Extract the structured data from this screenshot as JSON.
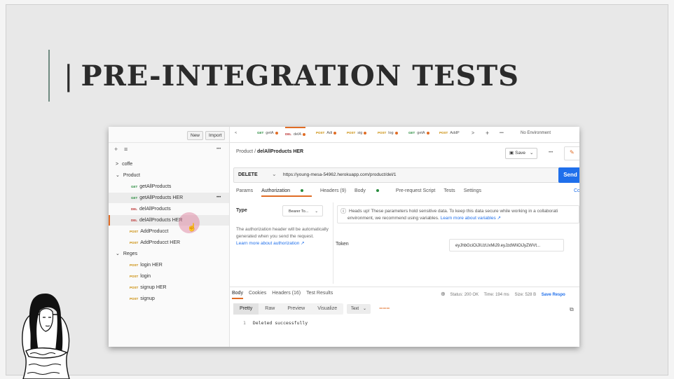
{
  "slide": {
    "title_bar": "|",
    "title": "PRE-INTEGRATION TESTS"
  },
  "sidebar": {
    "new_btn": "New",
    "import_btn": "Import",
    "tools": {
      "plus": "+",
      "filter": "≡",
      "more": "•••"
    },
    "tree": [
      {
        "type": "folder",
        "label": "coffe",
        "icon": "chevron-right-icon"
      },
      {
        "type": "folder",
        "label": "Product",
        "icon": "chevron-down-icon"
      },
      {
        "type": "req",
        "method": "GET",
        "label": "getAllProducts"
      },
      {
        "type": "req",
        "method": "GET",
        "label": "getAllProducts HER",
        "more": "•••"
      },
      {
        "type": "req",
        "method": "DEL",
        "label": "delAllProducts"
      },
      {
        "type": "req",
        "method": "DEL",
        "label": "delAllProducts HER"
      },
      {
        "type": "req",
        "method": "POST",
        "label": "AddProducct"
      },
      {
        "type": "req",
        "method": "POST",
        "label": "AddProducct HER"
      },
      {
        "type": "folder",
        "label": "Reges",
        "icon": "chevron-down-icon"
      },
      {
        "type": "req",
        "method": "POST",
        "label": "login HER"
      },
      {
        "type": "req",
        "method": "POST",
        "label": "login"
      },
      {
        "type": "req",
        "method": "POST",
        "label": "signup HER"
      },
      {
        "type": "req",
        "method": "POST",
        "label": "signup"
      }
    ]
  },
  "tabs": [
    {
      "method": "GET",
      "label": "getA",
      "dot": true
    },
    {
      "method": "DEL",
      "label": "delA",
      "dot": true,
      "active": true
    },
    {
      "method": "POST",
      "label": "Adi",
      "dot": true
    },
    {
      "method": "POST",
      "label": "sig",
      "dot": true
    },
    {
      "method": "POST",
      "label": "log",
      "dot": true
    },
    {
      "method": "GET",
      "label": "getA",
      "dot": true
    },
    {
      "method": "POST",
      "label": "AddP",
      "dot": false
    }
  ],
  "tab_controls": {
    "prev": "<",
    "next": ">",
    "add": "+",
    "more": "•••",
    "env": "No Environment"
  },
  "crumb": {
    "parent": "Product",
    "sep": "/",
    "current": "delAllProducts HER"
  },
  "save_btn": "Save",
  "save_more": "•••",
  "request": {
    "method": "DELETE",
    "url": "https://young-mesa-54962.herokuapp.com/product/del/1",
    "send": "Send"
  },
  "req_tabs": [
    "Params",
    "Authorization",
    "Headers (9)",
    "Body",
    "Pre-request Script",
    "Tests",
    "Settings"
  ],
  "req_tabs_right": "Co",
  "auth": {
    "type_label": "Type",
    "type_value": "Bearer To...",
    "help": "The authorization header will be automatically generated when you send the request.",
    "learn": "Learn more about authorization ↗",
    "notice_line1": "Heads up! These parameters hold sensitive data. To keep this data secure while working in a collaborati",
    "notice_line2": "environment, we recommend using variables.",
    "notice_link": "Learn more about variables ↗",
    "token_label": "Token",
    "token_value": "eyJhbGciOiJIUzUxMiJ9.eyJzdWIiOiJyZWVt..."
  },
  "response": {
    "tabs": [
      "Body",
      "Cookies",
      "Headers (16)",
      "Test Results"
    ],
    "status": "Status: 200 OK",
    "time": "Time: 194 ms",
    "size": "Size: 528 B",
    "save": "Save Respo",
    "formats": [
      "Pretty",
      "Raw",
      "Preview",
      "Visualize"
    ],
    "format_type": "Text",
    "line_no": "1",
    "code": "Deleted successfully"
  },
  "colors": {
    "accent": "#e06c25",
    "send": "#1f6feb",
    "get": "#2a8c3f",
    "del": "#b33333",
    "post": "#c98a00",
    "link": "#1f6feb"
  }
}
